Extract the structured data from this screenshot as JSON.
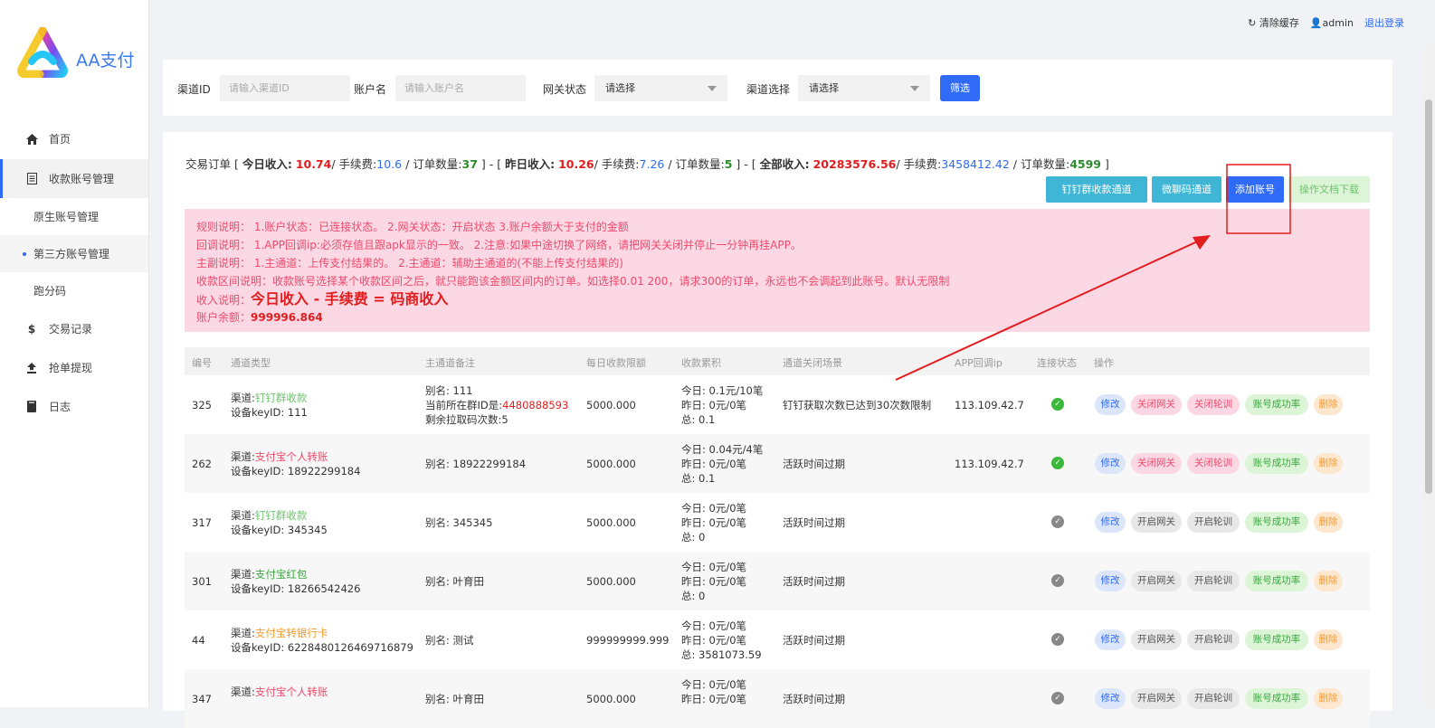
{
  "brand": {
    "name": "AA支付"
  },
  "topbar": {
    "clear_cache": "清除缓存",
    "user": "admin",
    "logout": "退出登录"
  },
  "sidebar": {
    "items": [
      {
        "label": "首页",
        "icon": "home-icon"
      },
      {
        "label": "收款账号管理",
        "icon": "document-icon"
      },
      {
        "label": "原生账号管理"
      },
      {
        "label": "第三方账号管理"
      },
      {
        "label": "跑分码"
      },
      {
        "label": "交易记录",
        "icon": "dollar-icon"
      },
      {
        "label": "抢单提现",
        "icon": "upload-icon"
      },
      {
        "label": "日志",
        "icon": "book-icon"
      }
    ]
  },
  "filter": {
    "channel_id_label": "渠道ID",
    "channel_id_placeholder": "请输入渠道ID",
    "account_label": "账户名",
    "account_placeholder": "请输入账户名",
    "gateway_label": "网关状态",
    "gateway_value": "请选择",
    "channel_select_label": "渠道选择",
    "channel_select_value": "请选择",
    "submit": "筛选"
  },
  "stats": {
    "prefix": "交易订单 [ ",
    "today_label": "今日收入:",
    "today_value": "10.74",
    "today_fee_label": "/ 手续费:",
    "today_fee": "10.6",
    "today_count_label": "/ 订单数量:",
    "today_count": "37",
    "sep1": " ] - [ ",
    "yesterday_label": "昨日收入:",
    "yesterday_value": "10.26",
    "yesterday_fee_label": "/ 手续费:",
    "yesterday_fee": "7.26",
    "yesterday_count_label": "/ 订单数量:",
    "yesterday_count": "5",
    "sep2": " ] - [ ",
    "total_label": "全部收入:",
    "total_value": "20283576.56",
    "total_fee_label": "/ 手续费:",
    "total_fee": "3458412.42",
    "total_count_label": "/ 订单数量:",
    "total_count": "4599",
    "suffix": " ]"
  },
  "actions": {
    "dingtalk": "钉钉群收款通道",
    "wechat": "微聊码通道",
    "add": "添加账号",
    "doc": "操作文档下载"
  },
  "notice": {
    "line1": "规则说明： 1.账户状态：已连接状态。 2.网关状态：开启状态 3.账户余额大于支付的金额",
    "line2": "回调说明： 1.APP回调ip:必须存值且跟apk显示的一致。 2.注意:如果中途切换了网络，请把网关关闭并停止一分钟再挂APP。",
    "line3": "主副说明： 1.主通道：上传支付结果的。 2.主通道：辅助主通道的(不能上传支付结果的)",
    "line4": "收款区间说明：收款账号选择某个收款区间之后，就只能跑该金额区间内的订单。如选择0.01 200，请求300的订单，永远也不会调起到此账号。默认无限制",
    "income_label": "收入说明：",
    "income_formula": "今日收入 - 手续费 = 码商收入",
    "balance_label": "账户余额：",
    "balance_value": "999996.864"
  },
  "table": {
    "headers": [
      "编号",
      "通道类型",
      "主通道备注",
      "每日收款限额",
      "收款累积",
      "通道关闭场景",
      "APP回调ip",
      "连接状态",
      "操作"
    ],
    "rows": [
      {
        "id": "325",
        "channel_label": "渠道:",
        "channel": "钉钉群收款",
        "channel_color": "#6fc16f",
        "device": "设备keyID: 111",
        "remark1": "别名: 111",
        "remark2": "当前所在群ID是:",
        "remark2_value": "4480888593",
        "remark3": "剩余拉取码次数:5",
        "limit": "5000.000",
        "acc1": "今日: 0.1元/10笔",
        "acc2": "昨日: 0元/0笔",
        "acc3": "总: 0.1",
        "scene": "钉钉获取次数已达到30次数限制",
        "ip": "113.109.42.7",
        "status": "connected",
        "status_color": "#3cb93c",
        "ops": [
          "修改",
          "关闭网关",
          "关闭轮训",
          "账号成功率",
          "删除"
        ]
      },
      {
        "id": "262",
        "channel_label": "渠道:",
        "channel": "支付宝个人转账",
        "channel_color": "#ee4a6b",
        "device": "设备keyID: 18922299184",
        "remark1": "别名: 18922299184",
        "remark2": "",
        "remark2_value": "",
        "remark3": "",
        "limit": "5000.000",
        "acc1": "今日: 0.04元/4笔",
        "acc2": "昨日: 0元/0笔",
        "acc3": "总: 0.1",
        "scene": "活跃时间过期",
        "ip": "113.109.42.7",
        "status": "connected",
        "status_color": "#3cb93c",
        "ops": [
          "修改",
          "关闭网关",
          "关闭轮训",
          "账号成功率",
          "删除"
        ]
      },
      {
        "id": "317",
        "channel_label": "渠道:",
        "channel": "钉钉群收款",
        "channel_color": "#6fc16f",
        "device": "设备keyID: 345345",
        "remark1": "别名: 345345",
        "remark2": "",
        "remark2_value": "",
        "remark3": "",
        "limit": "5000.000",
        "acc1": "今日: 0元/0笔",
        "acc2": "昨日: 0元/0笔",
        "acc3": "总: 0",
        "scene": "活跃时间过期",
        "ip": "",
        "status": "disconnected",
        "status_color": "#888888",
        "ops": [
          "修改",
          "开启网关",
          "开启轮训",
          "账号成功率",
          "删除"
        ]
      },
      {
        "id": "301",
        "channel_label": "渠道:",
        "channel": "支付宝红包",
        "channel_color": "#3aa640",
        "device": "设备keyID: 18266542426",
        "remark1": "别名: 叶育田",
        "remark2": "",
        "remark2_value": "",
        "remark3": "",
        "limit": "5000.000",
        "acc1": "今日: 0元/0笔",
        "acc2": "昨日: 0元/0笔",
        "acc3": "总: 0",
        "scene": "活跃时间过期",
        "ip": "",
        "status": "disconnected",
        "status_color": "#888888",
        "ops": [
          "修改",
          "开启网关",
          "开启轮训",
          "账号成功率",
          "删除"
        ]
      },
      {
        "id": "44",
        "channel_label": "渠道:",
        "channel": "支付宝转银行卡",
        "channel_color": "#f29b2f",
        "device": "设备keyID: 6228480126469716879",
        "remark1": "别名: 测试",
        "remark2": "",
        "remark2_value": "",
        "remark3": "",
        "limit": "999999999.999",
        "acc1": "今日: 0元/0笔",
        "acc2": "昨日: 0元/0笔",
        "acc3": "总: 3581073.59",
        "scene": "活跃时间过期",
        "ip": "",
        "status": "disconnected",
        "status_color": "#888888",
        "ops": [
          "修改",
          "开启网关",
          "开启轮训",
          "账号成功率",
          "删除"
        ]
      },
      {
        "id": "347",
        "channel_label": "渠道:",
        "channel": "支付宝个人转账",
        "channel_color": "#ee4a6b",
        "device": "",
        "remark1": "别名: 叶育田",
        "remark2": "",
        "remark2_value": "",
        "remark3": "",
        "limit": "5000.000",
        "acc1": "今日: 0元/0笔",
        "acc2": "昨日: 0元/0笔",
        "acc3": "",
        "scene": "活跃时间过期",
        "ip": "",
        "status": "disconnected",
        "status_color": "#888888",
        "ops": [
          "修改",
          "开启网关",
          "开启轮训",
          "账号成功率",
          "删除"
        ]
      }
    ]
  },
  "annotation": {
    "color": "#e21d1d"
  }
}
